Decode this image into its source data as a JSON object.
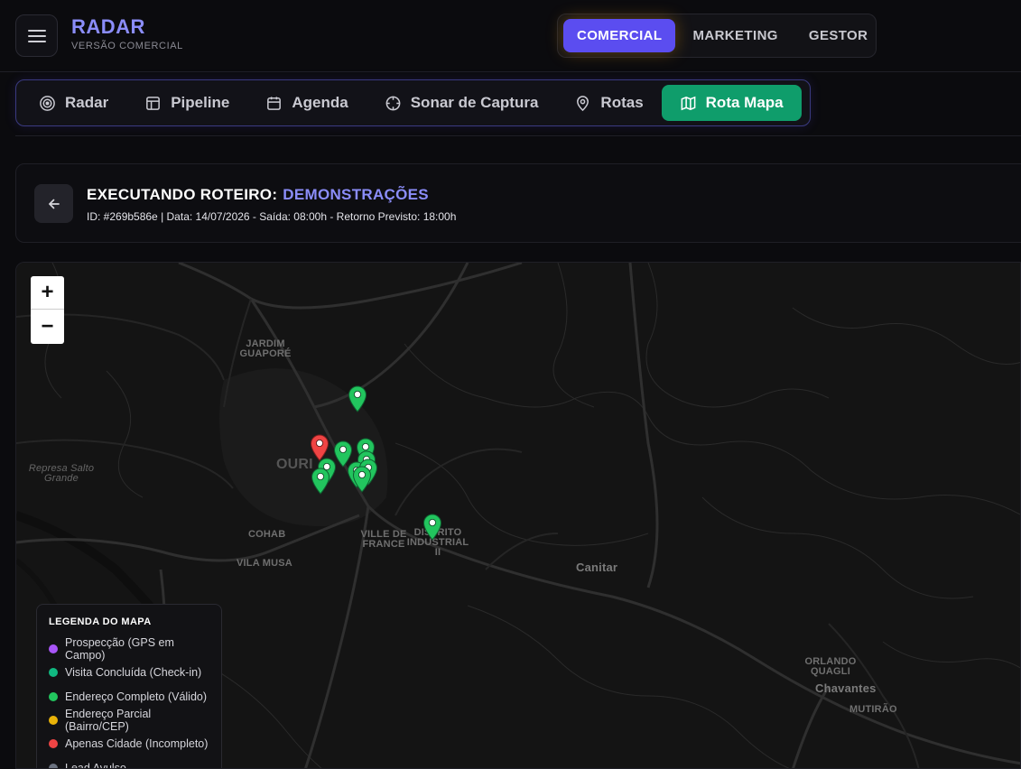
{
  "header": {
    "brand_title": "RADAR",
    "brand_subtitle": "VERSÃO COMERCIAL",
    "modes": [
      "COMERCIAL",
      "MARKETING",
      "GESTOR"
    ],
    "active_mode": "COMERCIAL"
  },
  "tabs": [
    {
      "label": "Radar",
      "icon": "radar-icon"
    },
    {
      "label": "Pipeline",
      "icon": "layout-icon"
    },
    {
      "label": "Agenda",
      "icon": "calendar-icon"
    },
    {
      "label": "Sonar de Captura",
      "icon": "crosshair-icon"
    },
    {
      "label": "Rotas",
      "icon": "map-pin-icon"
    },
    {
      "label": "Rota Mapa",
      "icon": "map-icon",
      "active": true
    }
  ],
  "route": {
    "prefix": "EXECUTANDO ROTEIRO:",
    "name": "DEMONSTRAÇÕES",
    "meta": "ID: #269b586e | Data: 14/07/2026 - Saída: 08:00h - Retorno Previsto: 18:00h"
  },
  "map": {
    "zoom_in": "+",
    "zoom_out": "−",
    "labels": {
      "jardim_guapore": "JARDIM GUAPORÉ",
      "represa": "Represa Salto Grande",
      "ourinhos": "OURI",
      "cohab": "COHAB",
      "vila_musa": "VILA MUSA",
      "ville_de_france": "VILLE DE FRANCE",
      "distrito_industrial": "DISTRITO INDUSTRIAL II",
      "canitar": "Canitar",
      "orlando_quagli": "ORLANDO QUAGLI",
      "chavantes": "Chavantes",
      "mutirao": "MUTIRÃO"
    }
  },
  "legend": {
    "title": "LEGENDA DO MAPA",
    "items": [
      {
        "label": "Prospecção (GPS em Campo)",
        "color": "#a855f7"
      },
      {
        "label": "Visita Concluída (Check-in)",
        "color": "#10b981"
      },
      {
        "label": "Endereço Completo (Válido)",
        "color": "#22c55e"
      },
      {
        "label": "Endereço Parcial (Bairro/CEP)",
        "color": "#eab308"
      },
      {
        "label": "Apenas Cidade (Incompleto)",
        "color": "#ef4444"
      },
      {
        "label": "Lead Avulso",
        "color": "#6b7280"
      }
    ]
  },
  "colors": {
    "accent": "#8b8df9",
    "active_mode": "#5b4df0",
    "active_tab": "#0f9d6b",
    "pin_green": "#22c55e",
    "pin_red": "#ef4444"
  }
}
